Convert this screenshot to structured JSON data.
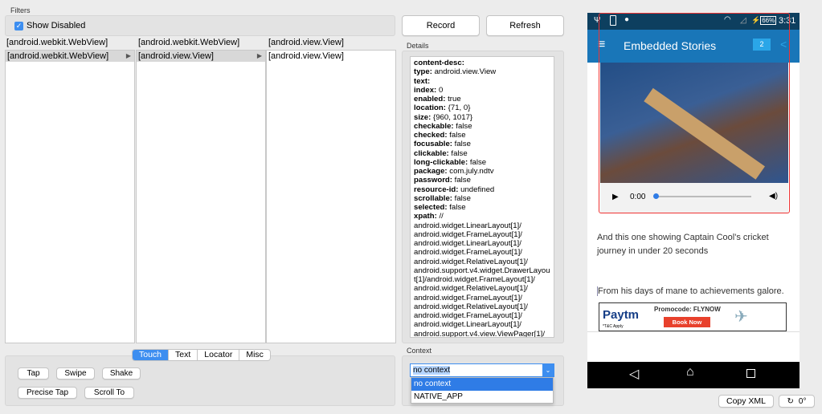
{
  "filters": {
    "label": "Filters",
    "show_disabled": "Show Disabled",
    "show_disabled_checked": true
  },
  "toolbar": {
    "record": "Record",
    "refresh": "Refresh"
  },
  "columns": [
    {
      "header": "[android.webkit.WebView]",
      "items": [
        "[android.webkit.WebView]"
      ]
    },
    {
      "header": "[android.webkit.WebView]",
      "items": [
        "[android.view.View]"
      ]
    },
    {
      "header": "[android.view.View]",
      "items": [
        "[android.view.View]"
      ]
    }
  ],
  "details": {
    "label": "Details",
    "props": [
      {
        "k": "content-desc:",
        "v": ""
      },
      {
        "k": "type:",
        "v": "android.view.View"
      },
      {
        "k": "text:",
        "v": ""
      },
      {
        "k": "index:",
        "v": "0"
      },
      {
        "k": "enabled:",
        "v": "true"
      },
      {
        "k": "location:",
        "v": "{71, 0}"
      },
      {
        "k": "size:",
        "v": "{960, 1017}"
      },
      {
        "k": "checkable:",
        "v": "false"
      },
      {
        "k": "checked:",
        "v": "false"
      },
      {
        "k": "focusable:",
        "v": "false"
      },
      {
        "k": "clickable:",
        "v": "false"
      },
      {
        "k": "long-clickable:",
        "v": "false"
      },
      {
        "k": "package:",
        "v": "com.july.ndtv"
      },
      {
        "k": "password:",
        "v": "false"
      },
      {
        "k": "resource-id:",
        "v": "undefined"
      },
      {
        "k": "scrollable:",
        "v": "false"
      },
      {
        "k": "selected:",
        "v": "false"
      },
      {
        "k": "xpath:",
        "v": "//"
      }
    ],
    "xpath_lines": [
      "android.widget.LinearLayout[1]/",
      "android.widget.FrameLayout[1]/",
      "android.widget.LinearLayout[1]/",
      "android.widget.FrameLayout[1]/",
      "android.widget.RelativeLayout[1]/",
      "android.support.v4.widget.DrawerLayou",
      "t[1]/android.widget.FrameLayout[1]/",
      "android.widget.RelativeLayout[1]/",
      "android.widget.FrameLayout[1]/",
      "android.widget.RelativeLayout[1]/",
      "android.widget.FrameLayout[1]/",
      "android.widget.LinearLayout[1]/",
      "android.support.v4.view.ViewPager[1]/"
    ]
  },
  "actions": {
    "tabs": [
      "Touch",
      "Text",
      "Locator",
      "Misc"
    ],
    "active_tab": "Touch",
    "tap": "Tap",
    "swipe": "Swipe",
    "shake": "Shake",
    "precise_tap": "Precise Tap",
    "scroll_to": "Scroll To"
  },
  "context": {
    "label": "Context",
    "selected": "no context",
    "options": [
      "no context",
      "NATIVE_APP"
    ]
  },
  "device": {
    "time": "3:31",
    "battery": "66%",
    "app_title": "Embedded Stories",
    "badge": "2",
    "video_time": "0:00",
    "para1": "And this one showing Captain Cool's cricket journey in under 20 seconds",
    "para2": "From his days of mane to achievements galore.",
    "ad": {
      "brand": "Paytm",
      "promo": "Promocode: FLYNOW",
      "cta": "Book Now",
      "tc": "*T&C Apply"
    },
    "appbar_color": "#1976b8",
    "statusbar_color": "#0d3f5f"
  },
  "footer": {
    "copy_xml": "Copy XML",
    "rotation": "0°"
  }
}
